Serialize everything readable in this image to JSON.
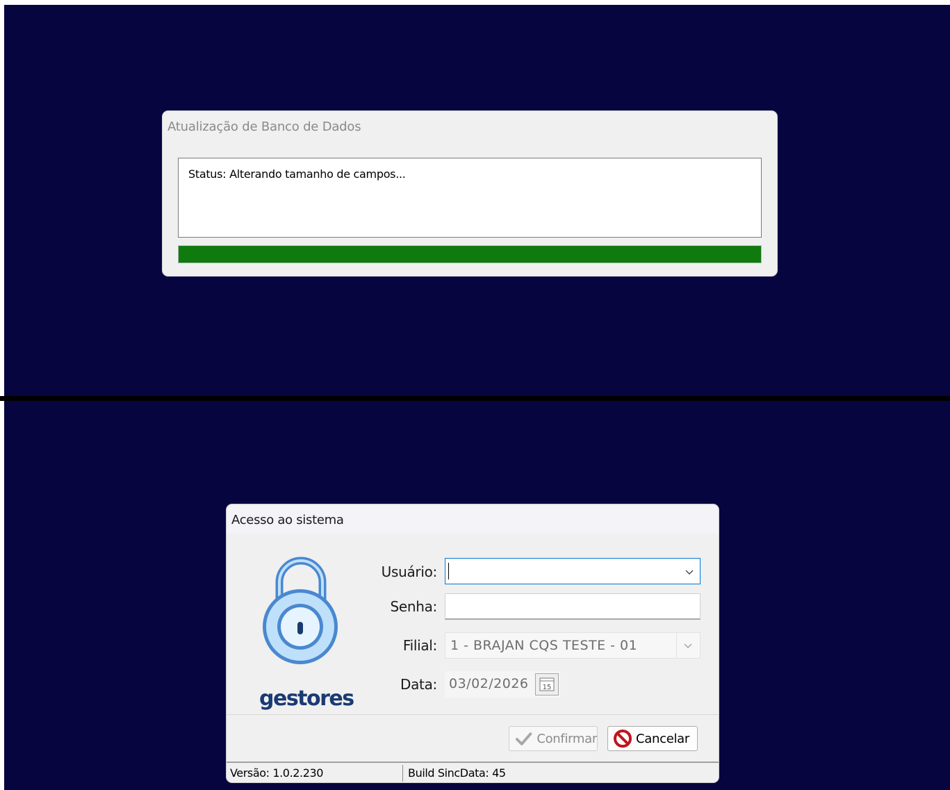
{
  "update_dialog": {
    "title": "Atualização de Banco de Dados",
    "status_label": "Status:",
    "status_text": "Alterando tamanho de campos...",
    "progress": 1.0,
    "progress_color": "#0f7b0f"
  },
  "login_dialog": {
    "title": "Acesso ao sistema",
    "brand": "gestores",
    "fields": {
      "usuario_label": "Usuário:",
      "usuario_value": "",
      "senha_label": "Senha:",
      "senha_value": "",
      "filial_label": "Filial:",
      "filial_value": "1 - BRAJAN CQS TESTE - 01",
      "data_label": "Data:",
      "data_value": "03/02/2026",
      "calendar_button": "15"
    },
    "buttons": {
      "confirm_label": "Confirmar",
      "cancel_label": "Cancelar"
    },
    "statusbar": {
      "version": "Versão: 1.0.2.230",
      "build": "Build SincData: 45"
    },
    "icons": {
      "lock": "lock-icon",
      "confirm": "check-icon",
      "cancel": "no-entry-icon",
      "calendar": "calendar-icon",
      "dropdown": "chevron-down-icon"
    },
    "colors": {
      "focus_border": "#0078d7",
      "brand_color": "#1a3a72",
      "lock_blue": "#4a88d0",
      "cancel_red": "#c0141c"
    }
  }
}
